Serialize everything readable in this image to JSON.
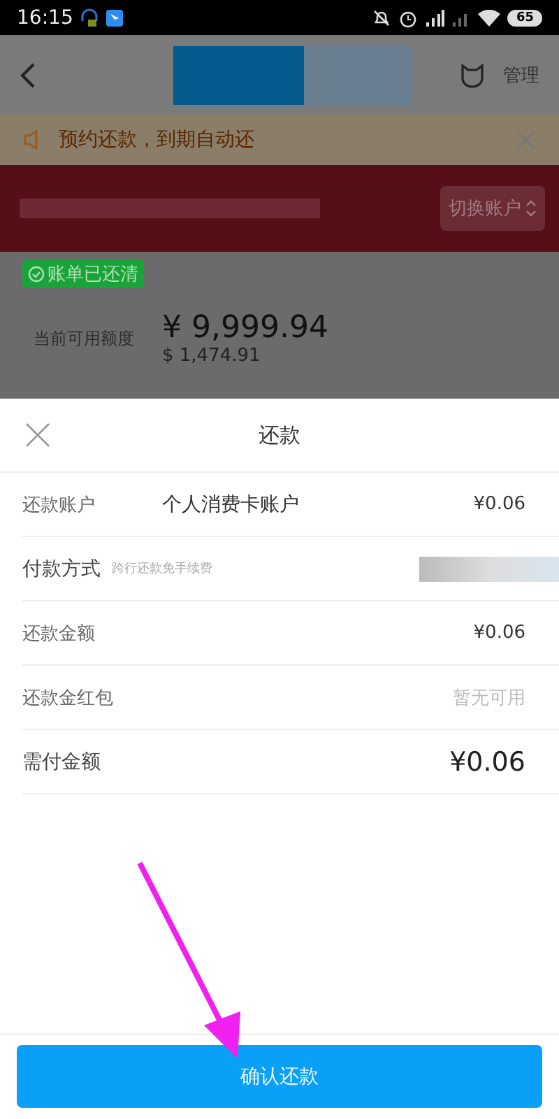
{
  "status_bar": {
    "time": "16:15",
    "battery": "65"
  },
  "nav": {
    "manage": "管理"
  },
  "notice": {
    "text": "预约还款，到期自动还"
  },
  "account_band": {
    "switch": "切换账户"
  },
  "bill": {
    "badge": "账单已还清",
    "credit_label": "当前可用额度",
    "credit_cny": "¥ 9,999.94",
    "credit_usd": "$ 1,474.91"
  },
  "sheet": {
    "title": "还款",
    "rows": [
      {
        "kind": "account",
        "label": "还款账户",
        "middle": "个人消费卡账户",
        "value": "¥0.06"
      },
      {
        "kind": "method",
        "label": "付款方式",
        "hint": "跨行还款免手续费"
      },
      {
        "kind": "plain",
        "label": "还款金额",
        "value": "¥0.06"
      },
      {
        "kind": "muted",
        "label": "还款金红包",
        "value": "暂无可用"
      },
      {
        "kind": "total",
        "label": "需付金额",
        "value": "¥0.06"
      }
    ],
    "confirm": "确认还款"
  }
}
